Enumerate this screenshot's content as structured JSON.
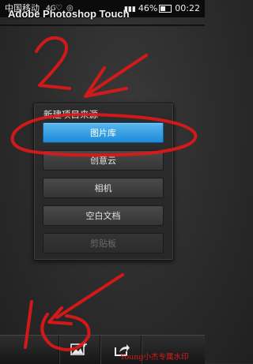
{
  "statusbar": {
    "carrier": "中国移动",
    "network": "4G",
    "battery": "46%",
    "time": "00:22"
  },
  "app": {
    "title": "Adobe Photoshop Touch"
  },
  "dialog": {
    "title": "新建项目来源",
    "options": [
      {
        "label": "图片库",
        "state": "selected"
      },
      {
        "label": "创意云",
        "state": "normal"
      },
      {
        "label": "相机",
        "state": "normal"
      },
      {
        "label": "空白文档",
        "state": "normal"
      },
      {
        "label": "剪贴板",
        "state": "disabled"
      }
    ]
  },
  "bottom_bar": {
    "icons": [
      "add-image-icon",
      "share-icon"
    ]
  },
  "watermark": "Young小杰专属水印",
  "annotation_color": "#e01818",
  "accent": "#2a95dd"
}
